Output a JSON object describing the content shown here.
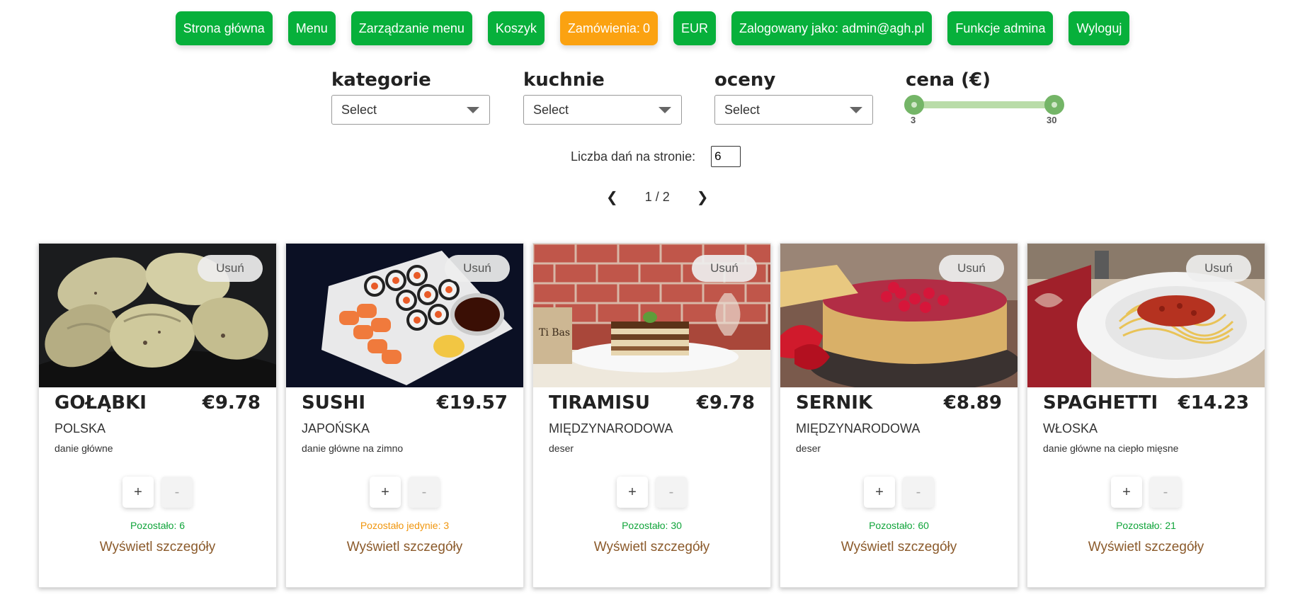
{
  "nav": {
    "home": "Strona główna",
    "menu": "Menu",
    "manage_menu": "Zarządzanie menu",
    "cart": "Koszyk",
    "orders_label": "Zamówienia:",
    "orders_count": "0",
    "currency": "EUR",
    "logged_as": "Zalogowany jako: admin@agh.pl",
    "admin_functions": "Funkcje admina",
    "logout": "Wyloguj"
  },
  "filters": {
    "categories": {
      "label": "kategorie",
      "value": "Select"
    },
    "cuisines": {
      "label": "kuchnie",
      "value": "Select"
    },
    "ratings": {
      "label": "oceny",
      "value": "Select"
    },
    "price": {
      "label": "cena (€)",
      "min": "3",
      "max": "30"
    }
  },
  "pagination": {
    "per_page_label": "Liczba dań na stronie:",
    "per_page_value": "6",
    "prev": "❮",
    "page_text": "1 / 2",
    "next": "❯"
  },
  "dishes": [
    {
      "name": "GOŁĄBKI",
      "price": "€9.78",
      "cuisine": "POLSKA",
      "type": "danie główne",
      "remove": "Usuń",
      "plus": "+",
      "minus": "-",
      "remaining": "Pozostało: 6",
      "details": "Wyświetl szczegóły",
      "remaining_color": "#10a43a"
    },
    {
      "name": "SUSHI",
      "price": "€19.57",
      "cuisine": "JAPOŃSKA",
      "type": "danie główne na zimno",
      "remove": "Usuń",
      "plus": "+",
      "minus": "-",
      "remaining": "Pozostało jedynie: 3",
      "details": "Wyświetl szczegóły",
      "remaining_color": "#f0960e"
    },
    {
      "name": "TIRAMISU",
      "price": "€9.78",
      "cuisine": "MIĘDZYNARODOWA",
      "type": "deser",
      "remove": "Usuń",
      "plus": "+",
      "minus": "-",
      "remaining": "Pozostało: 30",
      "details": "Wyświetl szczegóły",
      "remaining_color": "#10a43a"
    },
    {
      "name": "SERNIK",
      "price": "€8.89",
      "cuisine": "MIĘDZYNARODOWA",
      "type": "deser",
      "remove": "Usuń",
      "plus": "+",
      "minus": "-",
      "remaining": "Pozostało: 60",
      "details": "Wyświetl szczegóły",
      "remaining_color": "#10a43a"
    },
    {
      "name": "SPAGHETTI",
      "price": "€14.23",
      "cuisine": "WŁOSKA",
      "type": "danie główne na ciepło mięsne",
      "remove": "Usuń",
      "plus": "+",
      "minus": "-",
      "remaining": "Pozostało: 21",
      "details": "Wyświetl szczegóły",
      "remaining_color": "#10a43a"
    }
  ],
  "colors": {
    "nav_green": "#07b03b",
    "nav_orange": "#fba211",
    "details_brown": "#8b5a2b",
    "slider_green": "#74b567"
  }
}
